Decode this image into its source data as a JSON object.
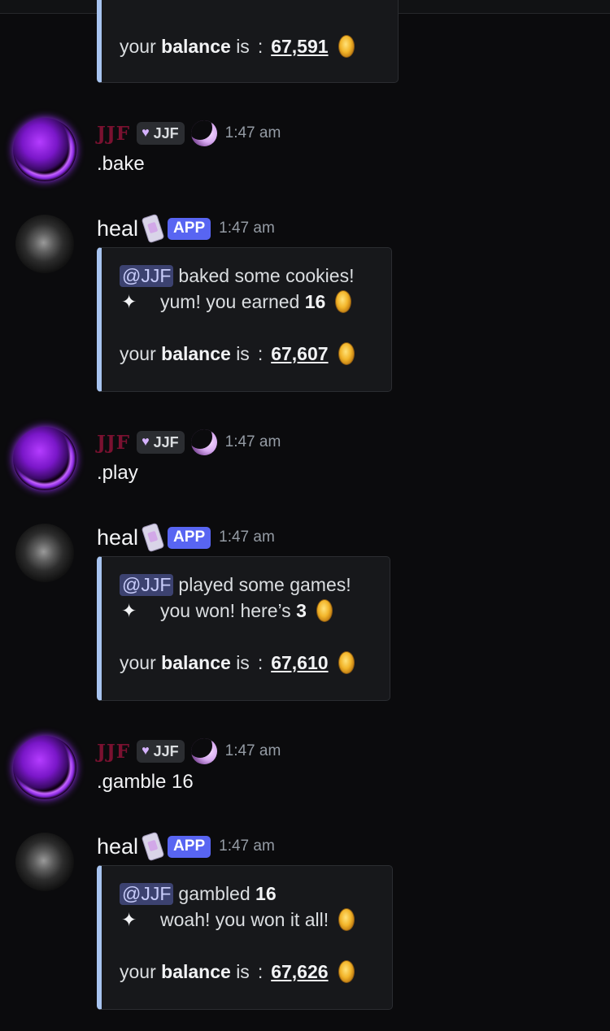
{
  "prev_embed": {
    "balance_prefix": "your",
    "balance_word": "balance",
    "balance_suffix": "is",
    "colon": ":",
    "amount": "67,591"
  },
  "messages": [
    {
      "author": "JJF",
      "tag": "JJF",
      "time": "1:47 am",
      "text": ".bake"
    },
    {
      "author": "heal",
      "badge": "APP",
      "time": "1:47 am",
      "embed": {
        "mention": "@JJF",
        "action": "baked some cookies!",
        "sparkle": "✦",
        "reward_text": "yum! you earned",
        "reward_amount": "16",
        "balance_prefix": "your",
        "balance_word": "balance",
        "balance_suffix": "is",
        "colon": ":",
        "amount": "67,607"
      }
    },
    {
      "author": "JJF",
      "tag": "JJF",
      "time": "1:47 am",
      "text": ".play"
    },
    {
      "author": "heal",
      "badge": "APP",
      "time": "1:47 am",
      "embed": {
        "mention": "@JJF",
        "action": "played some games!",
        "sparkle": "✦",
        "reward_text": "you won! here’s",
        "reward_amount": "3",
        "balance_prefix": "your",
        "balance_word": "balance",
        "balance_suffix": "is",
        "colon": ":",
        "amount": "67,610"
      }
    },
    {
      "author": "JJF",
      "tag": "JJF",
      "time": "1:47 am",
      "text": ".gamble 16"
    },
    {
      "author": "heal",
      "badge": "APP",
      "time": "1:47 am",
      "embed": {
        "mention": "@JJF",
        "action": "gambled",
        "action_amount": "16",
        "sparkle": "✦",
        "reward_text": "woah! you won it all!",
        "balance_prefix": "your",
        "balance_word": "balance",
        "balance_suffix": "is",
        "colon": ":",
        "amount": "67,626"
      }
    }
  ],
  "icons": {
    "tag_heart": "heart-icon",
    "moon": "moon-icon",
    "phone": "phone-icon",
    "coin": "coin-icon",
    "sparkle": "sparkle-icon"
  },
  "colors": {
    "app_badge": "#5865f2",
    "jjf_name": "#7a1130",
    "embed_border": "#a8c4f0",
    "mention_bg": "#3c4270"
  }
}
